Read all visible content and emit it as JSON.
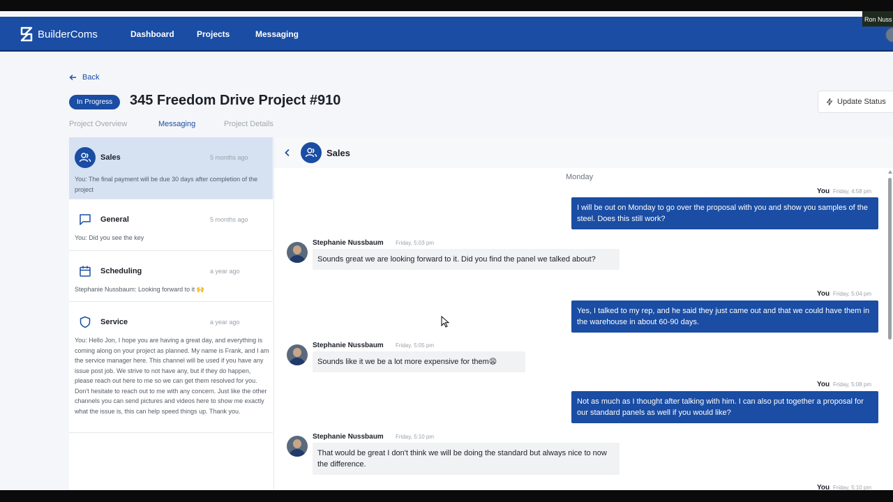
{
  "topbar": {
    "logo_text": "BuilderComs",
    "links": [
      "Dashboard",
      "Projects",
      "Messaging"
    ],
    "participant_name": "Ron Nuss"
  },
  "page": {
    "back_label": "Back",
    "status_badge": "In Progress",
    "title": "345 Freedom Drive Project #910",
    "update_status_label": "Update Status",
    "tabs": [
      "Project Overview",
      "Messaging",
      "Project Details"
    ],
    "active_tab": "Messaging"
  },
  "conversations": [
    {
      "name": "Sales",
      "time": "5 months ago",
      "preview": "You: The final payment will be due 30 days after completion of the project",
      "icon": "users-icon",
      "active": true
    },
    {
      "name": "General",
      "time": "5 months ago",
      "preview": "You: Did you see the key",
      "icon": "chat-icon",
      "active": false
    },
    {
      "name": "Scheduling",
      "time": "a year ago",
      "preview": "Stephanie Nussbaum: Looking forward to it 🙌",
      "icon": "calendar-icon",
      "active": false
    },
    {
      "name": "Service",
      "time": "a year ago",
      "preview": "You: Hello Jon, I hope you are having a great day, and everything is coming along on your project as planned. My name is Frank, and I am the service manager here. This channel will be used if you have any issue post job. We strive to not have any, but if they do happen, please reach out here to me so we can get them resolved for you. Don't hesitate to reach out to me with any concern. Just like the other channels you can send pictures and videos here to show me exactly what the issue is, this can help speed things up. Thank you.",
      "icon": "shield-icon",
      "active": false
    }
  ],
  "chat": {
    "title": "Sales",
    "day_label": "Monday",
    "messages": [
      {
        "from": "You",
        "time": "Friday, 4:58 pm",
        "text": "I will be out on Monday to go over the proposal with you and show you samples of the steel. Does this still work?"
      },
      {
        "from": "Stephanie Nussbaum",
        "time": "Friday, 5:03 pm",
        "text": "Sounds great we are looking forward to it. Did you find the panel we talked about?"
      },
      {
        "from": "You",
        "time": "Friday, 5:04 pm",
        "text": "Yes, I talked to my rep, and he said they just came out and that we could have them in the warehouse in about 60-90 days."
      },
      {
        "from": "Stephanie Nussbaum",
        "time": "Friday, 5:05 pm",
        "text": "Sounds like it we be a lot more expensive for them😩"
      },
      {
        "from": "You",
        "time": "Friday, 5:08 pm",
        "text": "Not as much as I thought after talking with him. I can also put together a proposal for our standard panels as well if you would like?"
      },
      {
        "from": "Stephanie Nussbaum",
        "time": "Friday, 5:10 pm",
        "text": "That would be great I don't think we will be doing the standard but always nice to now the difference."
      },
      {
        "from": "You",
        "time": "Friday, 5:10 pm",
        "text": ""
      }
    ]
  },
  "colors": {
    "brand": "#1a4da3",
    "active_conversation": "#d6e1f2"
  }
}
